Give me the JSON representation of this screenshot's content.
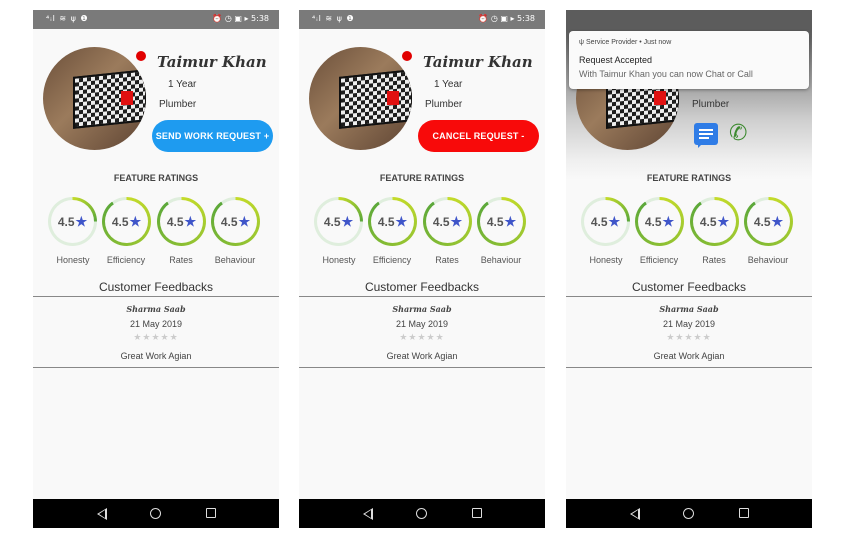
{
  "status_bar": {
    "left": "⁴ᵢl ≋ ψ ❶",
    "right": "⏰ ◷ ▣ ▸ 5:38"
  },
  "profile": {
    "name": "Taimur Khan",
    "experience": "1 Year",
    "profession": "Plumber"
  },
  "buttons": {
    "send_request": "SEND WORK REQUEST +",
    "cancel_request": "CANCEL REQUEST -"
  },
  "feature_ratings": {
    "title": "FEATURE RATINGS",
    "items": [
      {
        "value": "4.5",
        "label": "Honesty",
        "progress": 0.25
      },
      {
        "value": "4.5",
        "label": "Efficiency",
        "progress": 0.9
      },
      {
        "value": "4.5",
        "label": "Rates",
        "progress": 0.9
      },
      {
        "value": "4.5",
        "label": "Behaviour",
        "progress": 0.9
      }
    ]
  },
  "feedback": {
    "title": "Customer Feedbacks",
    "reviewer": "Sharma Saab",
    "date": "21 May 2019",
    "stars": "★★★★★",
    "text": "Great Work Agian"
  },
  "notification": {
    "app_line": "Service Provider • Just now",
    "title": "Request Accepted",
    "body": "With Taimur Khan you can now Chat or Call"
  },
  "colors": {
    "send_button": "#1e9bf0",
    "cancel_button": "#f80a0a",
    "online_dot": "#e10000",
    "star": "#3f55c9",
    "chat_icon": "#2f7ce6",
    "call_icon": "#3c8a2f"
  }
}
